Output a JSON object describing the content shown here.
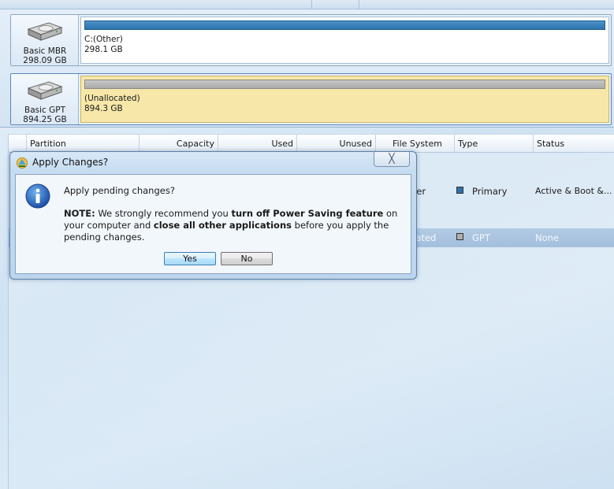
{
  "disks": [
    {
      "name": "Basic MBR",
      "size": "298.09 GB",
      "partition": {
        "label": "C:(Other)",
        "size": "298.1 GB",
        "bar_color": "#2e72ad",
        "selected": false
      }
    },
    {
      "name": "Basic GPT",
      "size": "894.25 GB",
      "partition": {
        "label": "(Unallocated)",
        "size": "894.3 GB",
        "bar_color": "#a9a9a9",
        "selected": true
      }
    }
  ],
  "list": {
    "columns": [
      "Partition",
      "Capacity",
      "Used",
      "Unused",
      "File System",
      "Type",
      "Status"
    ],
    "rows": [
      {
        "file_system": "her",
        "type": "Primary",
        "type_color": "#2e72ad",
        "status": "Active & Boot &..."
      },
      {
        "file_system": "cated",
        "type": "GPT",
        "type_color": "#b0b0b0",
        "status": "None"
      }
    ]
  },
  "dialog": {
    "title": "Apply Changes?",
    "close_label": "╳",
    "question": "Apply pending changes?",
    "note_prefix": "NOTE:",
    "note_part1": " We strongly recommend you ",
    "note_bold1": "turn off Power Saving feature",
    "note_part2": " on your computer and ",
    "note_bold2": "close all other applications",
    "note_part3": " before you apply the pending changes.",
    "yes_label": "Yes",
    "no_label": "No"
  },
  "icons": {
    "disk": "hard-disk-icon",
    "app": "app-icon",
    "info": "information-icon"
  }
}
